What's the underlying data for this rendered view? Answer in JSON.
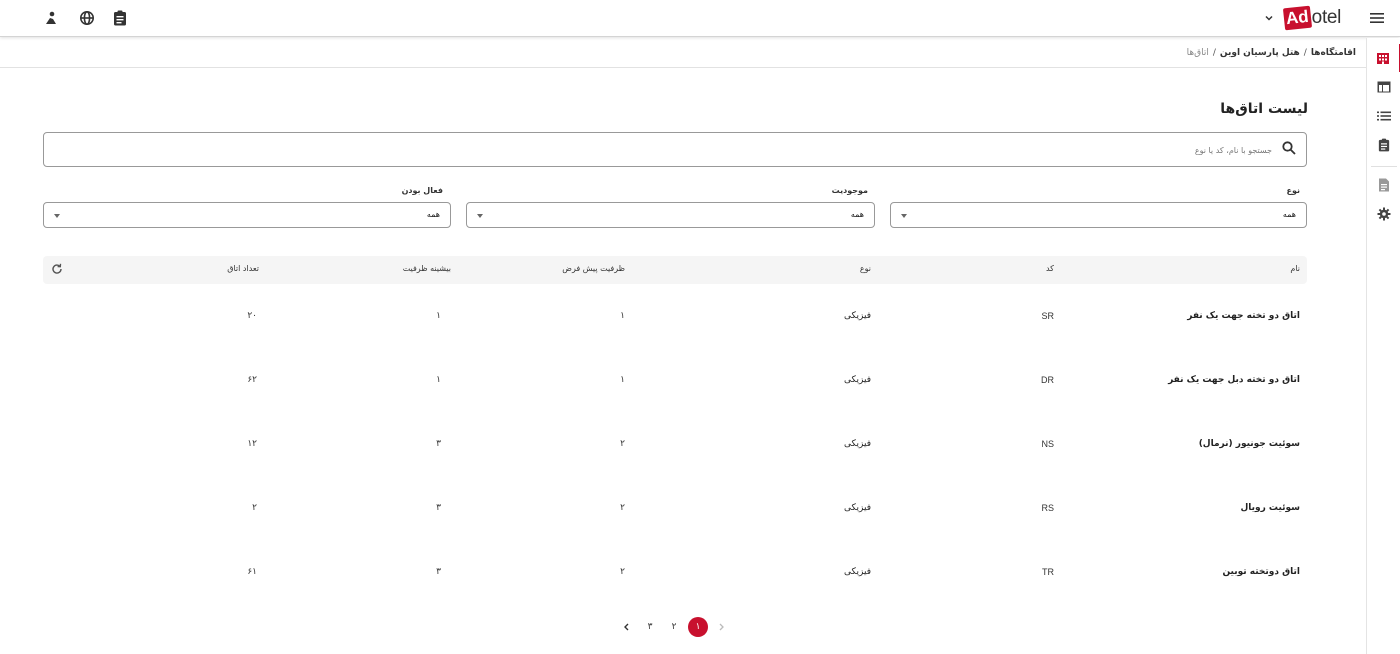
{
  "app": {
    "logo_box": "Ad",
    "logo_rest": "otel",
    "brand_color": "#c8102e"
  },
  "topbar": {
    "left_icons": [
      "person-icon",
      "globe-icon",
      "clipboard-icon"
    ],
    "right_icons": [
      "menu-icon",
      "chevron-down-icon"
    ]
  },
  "sidebar": {
    "items": [
      {
        "icon": "hotel-icon",
        "active": true
      },
      {
        "icon": "table-icon",
        "active": false
      },
      {
        "icon": "list-icon",
        "active": false
      },
      {
        "icon": "clipboard-icon",
        "active": false
      },
      {
        "icon": "document-icon",
        "active": false
      },
      {
        "icon": "gear-icon",
        "active": false
      }
    ]
  },
  "breadcrumb": {
    "items": [
      "اقامتگاه‌ها",
      "هتل پارسیان اوین",
      "اتاق‌ها"
    ],
    "separator": "/"
  },
  "page": {
    "title": "لیست اتاق‌ها"
  },
  "search": {
    "placeholder": "جستجو با نام، کد یا نوع",
    "value": ""
  },
  "filters": [
    {
      "label": "نوع",
      "value": "همه"
    },
    {
      "label": "موجودیت",
      "value": "همه"
    },
    {
      "label": "فعال بودن",
      "value": "همه"
    }
  ],
  "table": {
    "columns": [
      "نام",
      "کد",
      "نوع",
      "ظرفیت پیش فرض",
      "بیشینه ظرفیت",
      "تعداد اتاق"
    ],
    "rows": [
      {
        "name": "اتاق دو تخته جهت یک نفر",
        "code": "SR",
        "type": "فیزیکی",
        "default_capacity": "۱",
        "max_capacity": "۱",
        "room_count": "۲۰"
      },
      {
        "name": "اتاق دو تخته دبل جهت یک نفر",
        "code": "DR",
        "type": "فیزیکی",
        "default_capacity": "۱",
        "max_capacity": "۱",
        "room_count": "۶۲"
      },
      {
        "name": "سوئیت جونیور (نرمال)",
        "code": "NS",
        "type": "فیزیکی",
        "default_capacity": "۲",
        "max_capacity": "۳",
        "room_count": "۱۲"
      },
      {
        "name": "سوئیت رویال",
        "code": "RS",
        "type": "فیزیکی",
        "default_capacity": "۲",
        "max_capacity": "۳",
        "room_count": "۲"
      },
      {
        "name": "اتاق دوتخته توبین",
        "code": "TR",
        "type": "فیزیکی",
        "default_capacity": "۲",
        "max_capacity": "۳",
        "room_count": "۶۱"
      }
    ]
  },
  "pagination": {
    "pages": [
      "۱",
      "۲",
      "۳"
    ],
    "current": "۱"
  }
}
